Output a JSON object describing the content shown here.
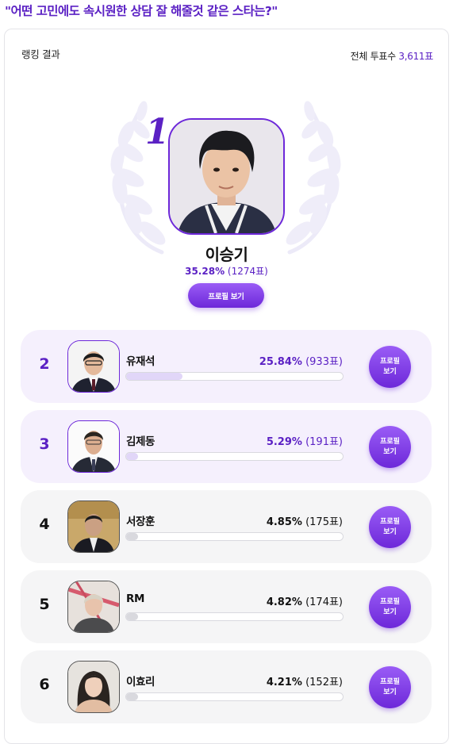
{
  "poll": {
    "question": "\"어떤 고민에도 속시원한 상담 잘 해줄것 같은 스타는?\""
  },
  "ranking": {
    "label": "랭킹 결과",
    "total_label": "전체 투표수",
    "total_value": "3,611표"
  },
  "winner": {
    "rank": "1",
    "name": "이승기",
    "percent": "35.28%",
    "votes": "(1274표)",
    "profile_button": "프로필 보기",
    "photo_icon": "portrait-photo"
  },
  "profile_button_line1": "프로필",
  "profile_button_line2": "보기",
  "entries": [
    {
      "rank": "2",
      "name": "유재석",
      "percent": "25.84%",
      "votes": "(933표)",
      "share": 0.2584,
      "highlight": true
    },
    {
      "rank": "3",
      "name": "김제동",
      "percent": "5.29%",
      "votes": "(191표)",
      "share": 0.0529,
      "highlight": true
    },
    {
      "rank": "4",
      "name": "서장훈",
      "percent": "4.85%",
      "votes": "(175표)",
      "share": 0.0485,
      "highlight": false
    },
    {
      "rank": "5",
      "name": "RM",
      "percent": "4.82%",
      "votes": "(174표)",
      "share": 0.0482,
      "highlight": false
    },
    {
      "rank": "6",
      "name": "이효리",
      "percent": "4.21%",
      "votes": "(152표)",
      "share": 0.0421,
      "highlight": false
    }
  ],
  "colors": {
    "accent": "#5b21c4",
    "button": "#7c3aed",
    "highlight_row": "#f5f0fd",
    "row": "#f5f5f6"
  }
}
